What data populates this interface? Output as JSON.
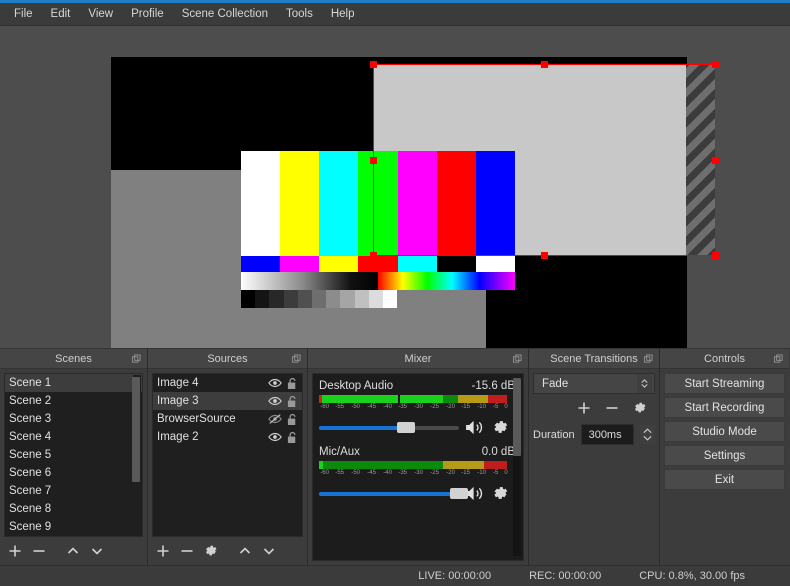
{
  "menu": {
    "items": [
      {
        "label": "File"
      },
      {
        "label": "Edit"
      },
      {
        "label": "View"
      },
      {
        "label": "Profile"
      },
      {
        "label": "Scene Collection"
      },
      {
        "label": "Tools"
      },
      {
        "label": "Help"
      }
    ]
  },
  "preview": {
    "color_bars_primary": [
      "#ffffff",
      "#ffff00",
      "#00ffff",
      "#00ff00",
      "#ff00ff",
      "#ff0000",
      "#0000ff"
    ],
    "color_bars_secondary": [
      "#0000ff",
      "#ff00ff",
      "#ffff00",
      "#ff0000",
      "#00ffff",
      "#000000",
      "#ffffff"
    ],
    "grayscale_steps": [
      "#000000",
      "#141414",
      "#282828",
      "#3c3c3c",
      "#505050",
      "#6e6e6e",
      "#8c8c8c",
      "#a5a5a5",
      "#c0c0c0",
      "#dcdcdc",
      "#ffffff"
    ],
    "selection_color": "#ff0000",
    "canvas_bg": "#4d4d4d"
  },
  "scenes": {
    "title": "Scenes",
    "items": [
      {
        "label": "Scene 1",
        "selected": true
      },
      {
        "label": "Scene 2",
        "selected": false
      },
      {
        "label": "Scene 3",
        "selected": false
      },
      {
        "label": "Scene 4",
        "selected": false
      },
      {
        "label": "Scene 5",
        "selected": false
      },
      {
        "label": "Scene 6",
        "selected": false
      },
      {
        "label": "Scene 7",
        "selected": false
      },
      {
        "label": "Scene 8",
        "selected": false
      },
      {
        "label": "Scene 9",
        "selected": false
      }
    ],
    "toolbar": {
      "add": "add-scene",
      "remove": "remove-scene",
      "move_up": "move-scene-up",
      "move_down": "move-scene-down"
    }
  },
  "sources": {
    "title": "Sources",
    "items": [
      {
        "label": "Image 4",
        "visible": true,
        "locked": false,
        "selected": false
      },
      {
        "label": "Image 3",
        "visible": true,
        "locked": false,
        "selected": true
      },
      {
        "label": "BrowserSource",
        "visible": false,
        "locked": false,
        "selected": false
      },
      {
        "label": "Image 2",
        "visible": true,
        "locked": false,
        "selected": false
      }
    ],
    "toolbar": {
      "add": "add-source",
      "remove": "remove-source",
      "properties": "source-properties",
      "move_up": "move-source-up",
      "move_down": "move-source-down"
    }
  },
  "mixer": {
    "title": "Mixer",
    "tick_labels": [
      "-60",
      "-55",
      "-50",
      "-45",
      "-40",
      "-35",
      "-30",
      "-25",
      "-20",
      "-15",
      "-10",
      "-5",
      "0"
    ],
    "sources": [
      {
        "name": "Desktop Audio",
        "level": "-15.6 dB",
        "level_pct": 74,
        "volume_pct": 62,
        "muted": false
      },
      {
        "name": "Mic/Aux",
        "level": "0.0 dB",
        "level_pct": 0,
        "volume_pct": 100,
        "muted": false
      }
    ]
  },
  "transitions": {
    "title": "Scene Transitions",
    "selected": "Fade",
    "duration_label": "Duration",
    "duration_value": "300ms",
    "add": "add-transition",
    "remove": "remove-transition",
    "properties": "transition-properties"
  },
  "controls": {
    "title": "Controls",
    "buttons": [
      {
        "label": "Start Streaming"
      },
      {
        "label": "Start Recording"
      },
      {
        "label": "Studio Mode"
      },
      {
        "label": "Settings"
      },
      {
        "label": "Exit"
      }
    ]
  },
  "status": {
    "live": "LIVE: 00:00:00",
    "rec": "REC: 00:00:00",
    "cpu": "CPU: 0.8%, 30.00 fps"
  }
}
